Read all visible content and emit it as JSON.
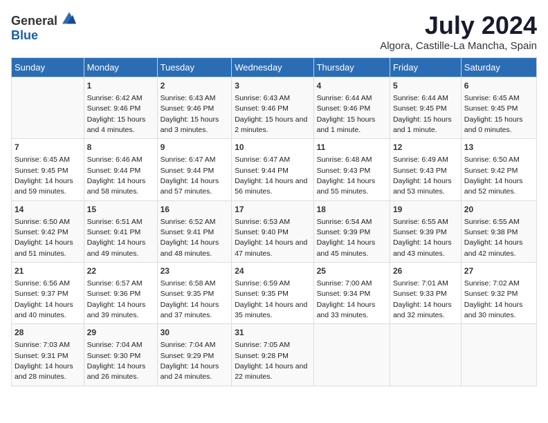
{
  "logo": {
    "general": "General",
    "blue": "Blue"
  },
  "title": "July 2024",
  "subtitle": "Algora, Castille-La Mancha, Spain",
  "days": [
    "Sunday",
    "Monday",
    "Tuesday",
    "Wednesday",
    "Thursday",
    "Friday",
    "Saturday"
  ],
  "weeks": [
    [
      {
        "date": "",
        "sunrise": "",
        "sunset": "",
        "daylight": ""
      },
      {
        "date": "1",
        "sunrise": "Sunrise: 6:42 AM",
        "sunset": "Sunset: 9:46 PM",
        "daylight": "Daylight: 15 hours and 4 minutes."
      },
      {
        "date": "2",
        "sunrise": "Sunrise: 6:43 AM",
        "sunset": "Sunset: 9:46 PM",
        "daylight": "Daylight: 15 hours and 3 minutes."
      },
      {
        "date": "3",
        "sunrise": "Sunrise: 6:43 AM",
        "sunset": "Sunset: 9:46 PM",
        "daylight": "Daylight: 15 hours and 2 minutes."
      },
      {
        "date": "4",
        "sunrise": "Sunrise: 6:44 AM",
        "sunset": "Sunset: 9:46 PM",
        "daylight": "Daylight: 15 hours and 1 minute."
      },
      {
        "date": "5",
        "sunrise": "Sunrise: 6:44 AM",
        "sunset": "Sunset: 9:45 PM",
        "daylight": "Daylight: 15 hours and 1 minute."
      },
      {
        "date": "6",
        "sunrise": "Sunrise: 6:45 AM",
        "sunset": "Sunset: 9:45 PM",
        "daylight": "Daylight: 15 hours and 0 minutes."
      }
    ],
    [
      {
        "date": "7",
        "sunrise": "Sunrise: 6:45 AM",
        "sunset": "Sunset: 9:45 PM",
        "daylight": "Daylight: 14 hours and 59 minutes."
      },
      {
        "date": "8",
        "sunrise": "Sunrise: 6:46 AM",
        "sunset": "Sunset: 9:44 PM",
        "daylight": "Daylight: 14 hours and 58 minutes."
      },
      {
        "date": "9",
        "sunrise": "Sunrise: 6:47 AM",
        "sunset": "Sunset: 9:44 PM",
        "daylight": "Daylight: 14 hours and 57 minutes."
      },
      {
        "date": "10",
        "sunrise": "Sunrise: 6:47 AM",
        "sunset": "Sunset: 9:44 PM",
        "daylight": "Daylight: 14 hours and 56 minutes."
      },
      {
        "date": "11",
        "sunrise": "Sunrise: 6:48 AM",
        "sunset": "Sunset: 9:43 PM",
        "daylight": "Daylight: 14 hours and 55 minutes."
      },
      {
        "date": "12",
        "sunrise": "Sunrise: 6:49 AM",
        "sunset": "Sunset: 9:43 PM",
        "daylight": "Daylight: 14 hours and 53 minutes."
      },
      {
        "date": "13",
        "sunrise": "Sunrise: 6:50 AM",
        "sunset": "Sunset: 9:42 PM",
        "daylight": "Daylight: 14 hours and 52 minutes."
      }
    ],
    [
      {
        "date": "14",
        "sunrise": "Sunrise: 6:50 AM",
        "sunset": "Sunset: 9:42 PM",
        "daylight": "Daylight: 14 hours and 51 minutes."
      },
      {
        "date": "15",
        "sunrise": "Sunrise: 6:51 AM",
        "sunset": "Sunset: 9:41 PM",
        "daylight": "Daylight: 14 hours and 49 minutes."
      },
      {
        "date": "16",
        "sunrise": "Sunrise: 6:52 AM",
        "sunset": "Sunset: 9:41 PM",
        "daylight": "Daylight: 14 hours and 48 minutes."
      },
      {
        "date": "17",
        "sunrise": "Sunrise: 6:53 AM",
        "sunset": "Sunset: 9:40 PM",
        "daylight": "Daylight: 14 hours and 47 minutes."
      },
      {
        "date": "18",
        "sunrise": "Sunrise: 6:54 AM",
        "sunset": "Sunset: 9:39 PM",
        "daylight": "Daylight: 14 hours and 45 minutes."
      },
      {
        "date": "19",
        "sunrise": "Sunrise: 6:55 AM",
        "sunset": "Sunset: 9:39 PM",
        "daylight": "Daylight: 14 hours and 43 minutes."
      },
      {
        "date": "20",
        "sunrise": "Sunrise: 6:55 AM",
        "sunset": "Sunset: 9:38 PM",
        "daylight": "Daylight: 14 hours and 42 minutes."
      }
    ],
    [
      {
        "date": "21",
        "sunrise": "Sunrise: 6:56 AM",
        "sunset": "Sunset: 9:37 PM",
        "daylight": "Daylight: 14 hours and 40 minutes."
      },
      {
        "date": "22",
        "sunrise": "Sunrise: 6:57 AM",
        "sunset": "Sunset: 9:36 PM",
        "daylight": "Daylight: 14 hours and 39 minutes."
      },
      {
        "date": "23",
        "sunrise": "Sunrise: 6:58 AM",
        "sunset": "Sunset: 9:35 PM",
        "daylight": "Daylight: 14 hours and 37 minutes."
      },
      {
        "date": "24",
        "sunrise": "Sunrise: 6:59 AM",
        "sunset": "Sunset: 9:35 PM",
        "daylight": "Daylight: 14 hours and 35 minutes."
      },
      {
        "date": "25",
        "sunrise": "Sunrise: 7:00 AM",
        "sunset": "Sunset: 9:34 PM",
        "daylight": "Daylight: 14 hours and 33 minutes."
      },
      {
        "date": "26",
        "sunrise": "Sunrise: 7:01 AM",
        "sunset": "Sunset: 9:33 PM",
        "daylight": "Daylight: 14 hours and 32 minutes."
      },
      {
        "date": "27",
        "sunrise": "Sunrise: 7:02 AM",
        "sunset": "Sunset: 9:32 PM",
        "daylight": "Daylight: 14 hours and 30 minutes."
      }
    ],
    [
      {
        "date": "28",
        "sunrise": "Sunrise: 7:03 AM",
        "sunset": "Sunset: 9:31 PM",
        "daylight": "Daylight: 14 hours and 28 minutes."
      },
      {
        "date": "29",
        "sunrise": "Sunrise: 7:04 AM",
        "sunset": "Sunset: 9:30 PM",
        "daylight": "Daylight: 14 hours and 26 minutes."
      },
      {
        "date": "30",
        "sunrise": "Sunrise: 7:04 AM",
        "sunset": "Sunset: 9:29 PM",
        "daylight": "Daylight: 14 hours and 24 minutes."
      },
      {
        "date": "31",
        "sunrise": "Sunrise: 7:05 AM",
        "sunset": "Sunset: 9:28 PM",
        "daylight": "Daylight: 14 hours and 22 minutes."
      },
      {
        "date": "",
        "sunrise": "",
        "sunset": "",
        "daylight": ""
      },
      {
        "date": "",
        "sunrise": "",
        "sunset": "",
        "daylight": ""
      },
      {
        "date": "",
        "sunrise": "",
        "sunset": "",
        "daylight": ""
      }
    ]
  ]
}
